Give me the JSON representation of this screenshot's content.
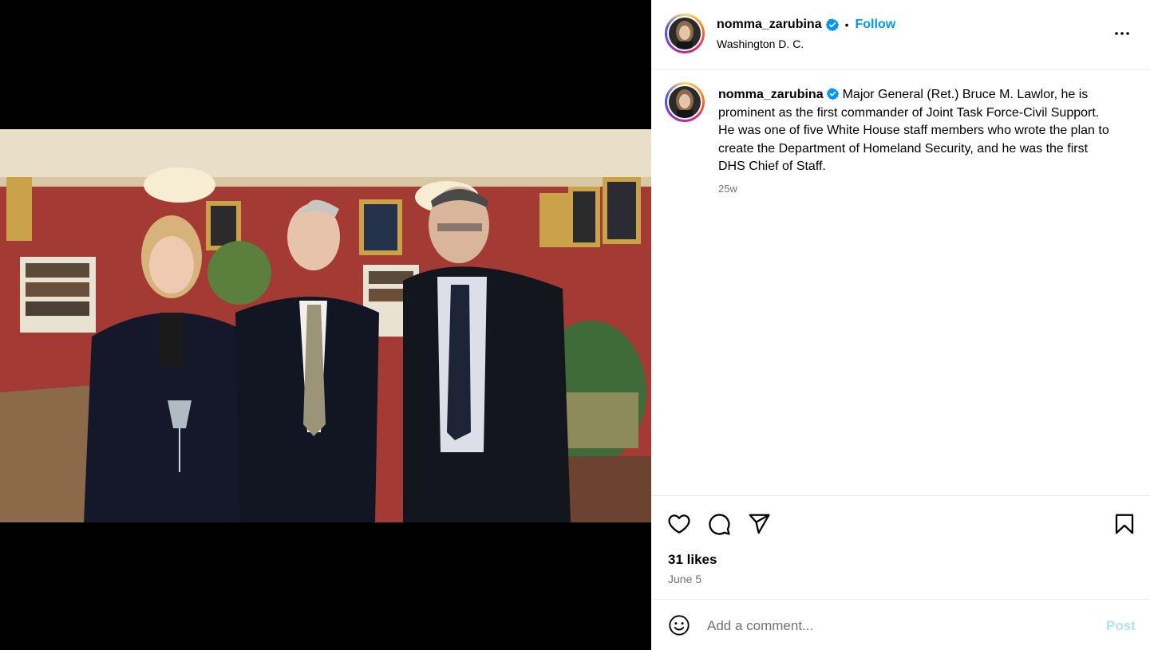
{
  "post": {
    "username": "nomma_zarubina",
    "location": "Washington D. C.",
    "follow_label": "Follow",
    "separator": "•",
    "caption": "Major General (Ret.) Bruce M. Lawlor, he is prominent as the first commander of Joint Task Force-Civil Support. He was one of five White House staff members who wrote the plan to create the Department of Homeland Security, and he was the first DHS Chief of Staff.",
    "age": "25w",
    "likes": "31 likes",
    "date": "June 5"
  },
  "comment": {
    "placeholder": "Add a comment...",
    "post_label": "Post"
  },
  "colors": {
    "accent": "#0095f6",
    "post_disabled": "#b2dffc",
    "muted": "#737373",
    "media_bg": "#000000"
  },
  "icons": [
    "verified-badge-icon",
    "more-options-icon",
    "heart-icon",
    "comment-icon",
    "share-icon",
    "bookmark-icon",
    "emoji-icon"
  ]
}
